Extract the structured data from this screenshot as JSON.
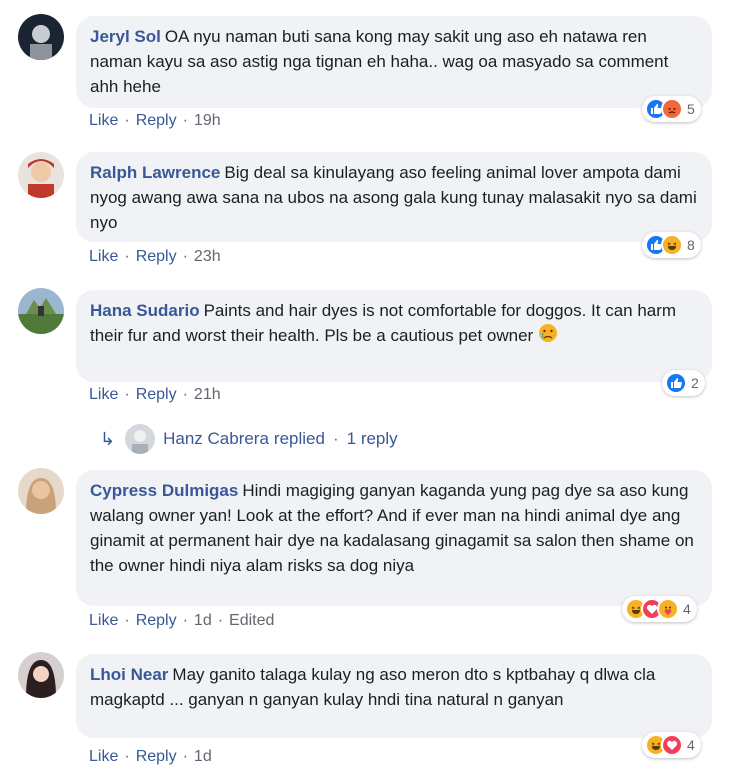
{
  "comments": [
    {
      "author": "Jeryl Sol",
      "text": "OA nyu naman buti sana kong may sakit ung aso eh natawa ren naman kayu sa aso astig nga tignan eh haha.. wag oa masyado sa comment ahh hehe",
      "time": "19h",
      "reactions": [
        "like-icon",
        "angry-icon"
      ],
      "reaction_count": "5"
    },
    {
      "author": "Ralph Lawrence",
      "text": "Big deal sa kinulayang aso feeling animal lover ampota dami nyog awang awa sana na ubos na asong gala kung tunay malasakit nyo sa dami nyo",
      "time": "23h",
      "reactions": [
        "like-icon",
        "haha-icon"
      ],
      "reaction_count": "8"
    },
    {
      "author": "Hana Sudario",
      "text": "Paints and hair dyes is not comfortable for doggos. It can harm their fur and worst their health. Pls be a cautious pet owner",
      "time": "21h",
      "reactions": [
        "like-icon"
      ],
      "reaction_count": "2"
    },
    {
      "author": "Cypress Dulmigas",
      "text": "Hindi magiging ganyan kaganda yung pag dye sa aso kung walang owner yan! Look at the effort? And if ever man na hindi animal dye ang ginamit at permanent hair dye na kadalasang ginagamit sa salon then shame on the owner hindi niya alam risks sa dog niya",
      "time": "1d",
      "edited": "Edited",
      "reactions": [
        "haha-icon",
        "love-icon",
        "care-icon"
      ],
      "reaction_count": "4"
    },
    {
      "author": "Lhoi Near",
      "text": "May ganito talaga kulay ng aso meron dto s kptbahay q dlwa cla magkaptd ... ganyan n ganyan kulay hndi tina natural n ganyan",
      "time": "1d",
      "reactions": [
        "haha-icon",
        "love-icon"
      ],
      "reaction_count": "4"
    }
  ],
  "actions": {
    "like": "Like",
    "reply": "Reply",
    "separator": "·"
  },
  "reply_summary": {
    "author": "Hanz Cabrera",
    "replied": "replied",
    "separator": "·",
    "count": "1 reply"
  },
  "colors": {
    "link": "#385898",
    "bubble": "#f0f2f5",
    "like": "#1877f2",
    "angry": "#f0673a",
    "haha": "#f7b125",
    "love": "#f33e58"
  }
}
